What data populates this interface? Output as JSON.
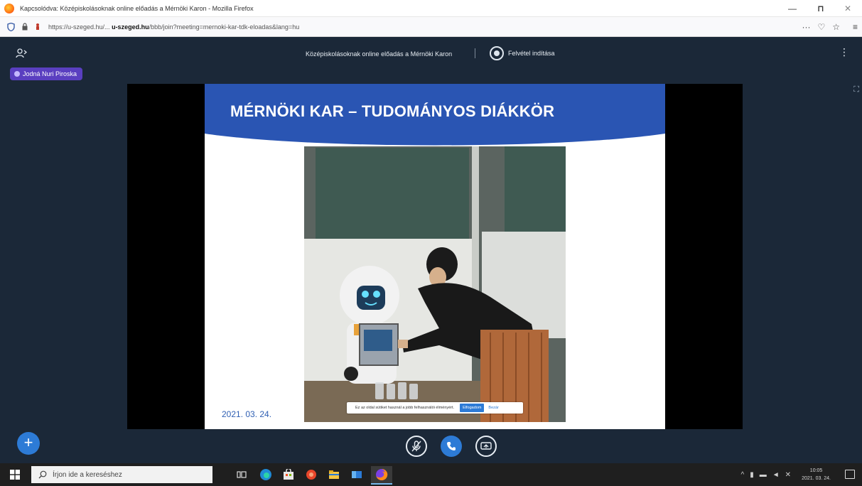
{
  "browser": {
    "window_title": "Kapcsolódva: Középiskolásoknak online előadás a Mérnöki Karon - Mozilla Firefox",
    "url_prefix": "https://u-szeged.hu/... ",
    "url_host": "u-szeged.hu",
    "url_rest": "/bbb/join?meeting=mernoki-kar-tdk-eloadas&lang=hu",
    "window_controls": {
      "minimize": "—",
      "maximize": "⊓",
      "close": "✕"
    },
    "toolbar_icons": {
      "more": "···",
      "pocket": "♡",
      "bookmark": "☆",
      "menu": "≡"
    }
  },
  "meeting": {
    "title": "Középiskolásoknak online előadás a Mérnöki Karon",
    "recording_label": "Felvétel indítása",
    "presenter_name": "Jodná Nuri Piroska",
    "more_icon": "⋮",
    "fullscreen_icon": "⛶"
  },
  "slide": {
    "title": "MÉRNÖKI KAR – TUDOMÁNYOS DIÁKKÖR",
    "date": "2021. 03. 24.",
    "header_color": "#2a55b3"
  },
  "consent_bar": {
    "text": "Ez az oldal sütiket használ a jobb felhasználói élményért.",
    "accept_label": "Elfogadom",
    "close_label": "Bezár"
  },
  "controls": {
    "plus_label": "+"
  },
  "taskbar": {
    "search_placeholder": "Írjon ide a kereséshez",
    "clock_time": "10:05",
    "clock_date": "2021. 03. 24."
  },
  "colors": {
    "app_bg": "#1b2838",
    "accent": "#2d7bd6",
    "badge": "#5a3fc0"
  }
}
